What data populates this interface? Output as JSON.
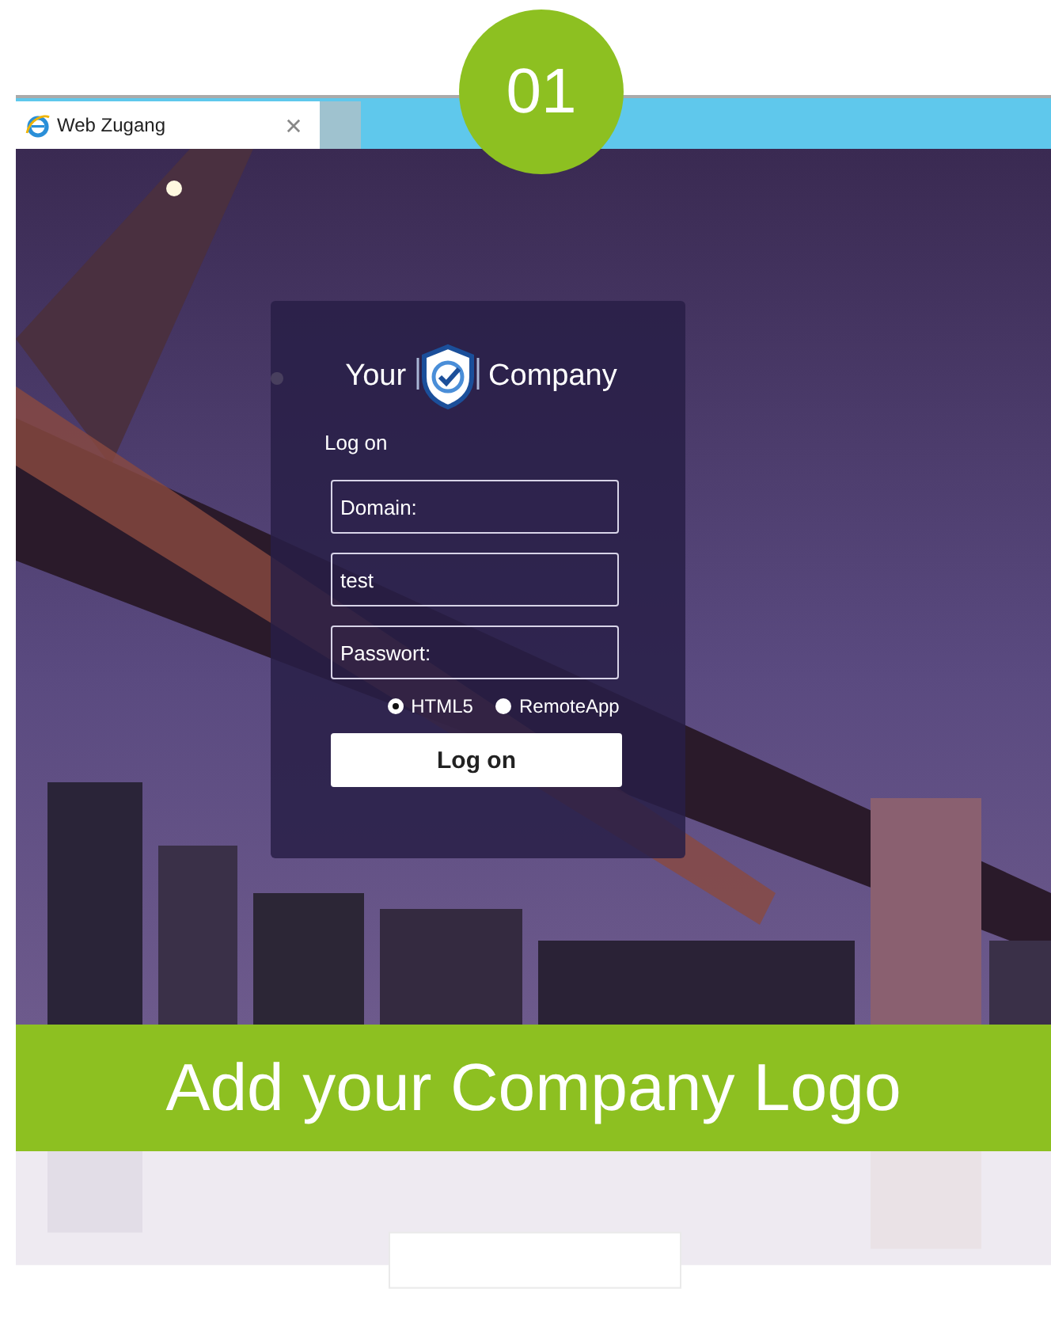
{
  "badge": "01",
  "browser": {
    "tabs": [
      {
        "title": "Web Zugang",
        "selected": true
      }
    ]
  },
  "login": {
    "brand_left": "Your",
    "brand_right": "Company",
    "heading": "Log on",
    "fields": [
      {
        "placeholder": "Domain:"
      },
      {
        "value": "test"
      },
      {
        "placeholder": "Passwort:"
      }
    ],
    "modes": [
      {
        "label": "HTML5",
        "selected": true
      },
      {
        "label": "RemoteApp",
        "selected": false
      }
    ],
    "submit": "Log on"
  },
  "banner": "Add your Company Logo"
}
